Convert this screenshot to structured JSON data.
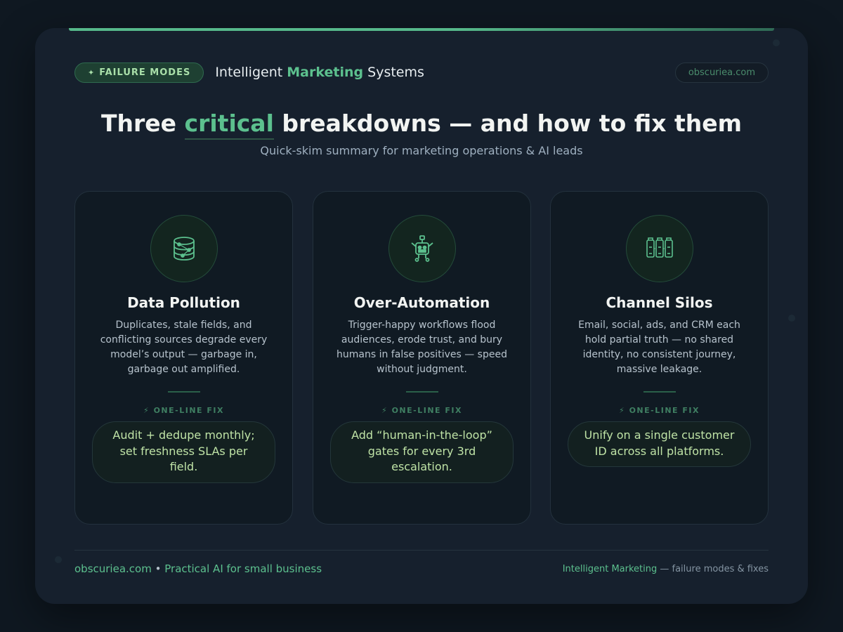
{
  "header": {
    "badge_icon": "✦",
    "badge_label": "FAILURE MODES",
    "brand_prefix": "Intelligent",
    "brand_accent": "Marketing",
    "brand_suffix": "Systems",
    "site_pill": "obscuriea.com"
  },
  "hero": {
    "title_prefix": "Three",
    "title_accent": "critical",
    "title_suffix": "breakdowns — and how to fix them",
    "subtitle": "Quick-skim summary for marketing operations & AI leads"
  },
  "cards": [
    {
      "icon": "database-icon",
      "title": "Data Pollution",
      "description": "Duplicates, stale fields, and conflicting sources degrade every model’s output — garbage in, garbage out amplified.",
      "fix_label": "⚡ ONE-LINE FIX",
      "fix": "Audit + dedupe monthly; set freshness SLAs per field."
    },
    {
      "icon": "robot-icon",
      "title": "Over-Automation",
      "description": "Trigger-happy workflows flood audiences, erode trust, and bury humans in false positives — speed without judgment.",
      "fix_label": "⚡ ONE-LINE FIX",
      "fix": "Add “human-in-the-loop” gates for every 3rd escalation."
    },
    {
      "icon": "silos-icon",
      "title": "Channel Silos",
      "description": "Email, social, ads, and CRM each hold partial truth — no shared identity, no consistent journey, massive leakage.",
      "fix_label": "⚡ ONE-LINE FIX",
      "fix": "Unify on a single customer ID across all platforms."
    }
  ],
  "footer": {
    "site": "obscuriea.com",
    "separator": "•",
    "tagline": "Practical AI for small business",
    "right_accent": "Intelligent Marketing",
    "right_rest": "— failure modes & fixes"
  },
  "colors": {
    "background": "#0f1821",
    "panel": "#16202d",
    "accent_green": "#5cc08e",
    "fix_text": "#bfe3a6"
  }
}
